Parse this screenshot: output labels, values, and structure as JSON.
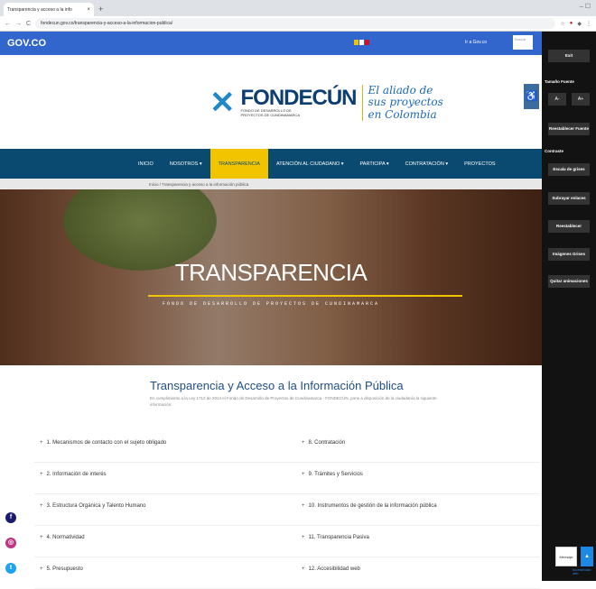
{
  "browser": {
    "tab_title": "Transparencia y acceso a la info",
    "close_glyph": "×",
    "new_tab_glyph": "+",
    "window_controls": "–  ☐",
    "back": "←",
    "forward": "→",
    "reload": "C",
    "url": "fondecun.gov.co/transparencia-y-acceso-a-la-informacion-publica/",
    "extensions": [
      "☆",
      "●",
      "◆",
      "⋮"
    ]
  },
  "gov_bar": {
    "logo": "GOV.CO",
    "right_text": "Ir a Gov.co",
    "search_placeholder": "Buscar"
  },
  "header": {
    "brand": "FONDECÚN",
    "brand_sub": "FONDO DE DESARROLLO DE PROYECTOS DE CUNDINAMARCA",
    "tagline_1": "El aliado de",
    "tagline_2": "sus proyectos en Colombia",
    "accessibility_icon": "♿"
  },
  "nav": {
    "items": [
      "INICIO",
      "NOSOTROS ▾",
      "TRANSPARENCIA",
      "ATENCIÓN AL CIUDADANO ▾",
      "PARTICIPA ▾",
      "CONTRATACIÓN ▾",
      "PROYECTOS"
    ]
  },
  "breadcrumb": "Inicio / Transparencia y acceso a la información pública",
  "hero": {
    "title": "TRANSPARENCIA",
    "subtitle": "FONDO DE DESARROLLO DE PROYECTOS DE CUNDINAMARCA"
  },
  "content": {
    "title": "Transparencia y Acceso a la Información Pública",
    "text": "En cumplimiento a la Ley 1712 de 2014 el Fondo de Desarrollo de Proyectos de Cundinamarca - FONDECÚN, pone a disposición de la ciudadanía la siguiente información:",
    "items": [
      "1. Mecanismos de contacto con el sujeto obligado",
      "8. Contratación",
      "2. Información de interés",
      "9. Trámites y Servicios",
      "3. Estructura Orgánica y Talento Humano",
      "10. Instrumentos de gestión de la información pública",
      "4. Normatividad",
      "11. Transparencia Pasiva",
      "5. Presupuesto",
      "12. Accesibilidad web"
    ],
    "plus": "+"
  },
  "social": [
    {
      "name": "facebook",
      "glyph": "f",
      "color": "#1a1a6e"
    },
    {
      "name": "instagram",
      "glyph": "◎",
      "color": "#c13584"
    },
    {
      "name": "twitter",
      "glyph": "t",
      "color": "#1da1f2"
    }
  ],
  "panel": {
    "exit": "Exit",
    "font_size_label": "Tamaño Fuente",
    "font_a_small": "A-",
    "font_a_large": "A+",
    "reset_font": "Reestablecer Fuente",
    "contrast_label": "Contraste",
    "black_white": "Escala de grises",
    "underline_links": "Subrayar enlaces",
    "reset": "Reestablecer",
    "images_bw": "Imágenes Grises",
    "remove_animations": "Quitar animaciones"
  },
  "footer": {
    "privacy_button": "Mensaje",
    "chat_icon": "▲",
    "caption": "Accesibilidad web"
  }
}
